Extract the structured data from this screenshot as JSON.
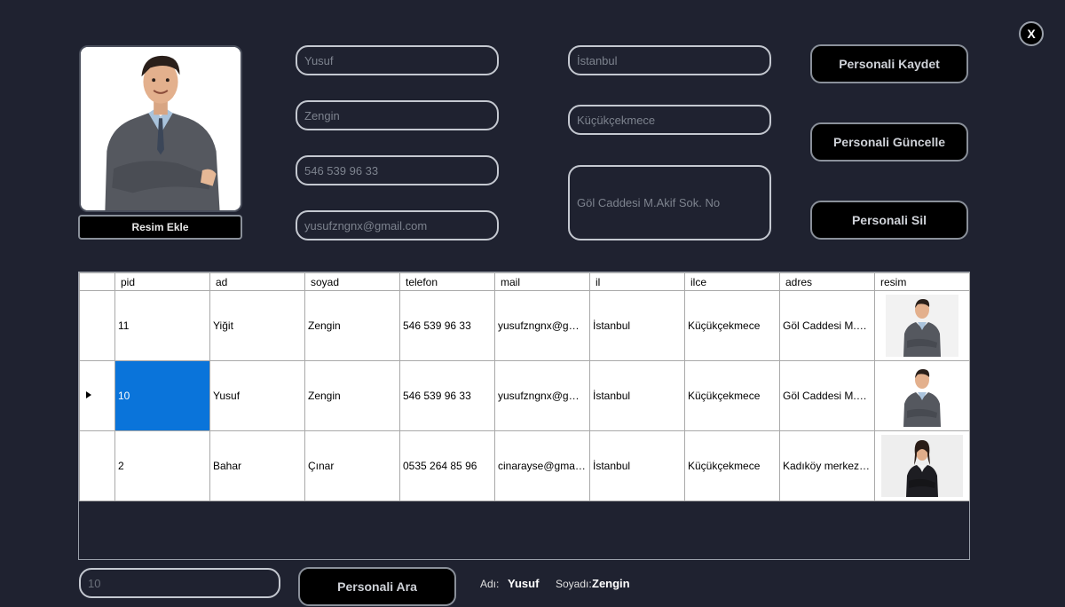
{
  "close_label": "X",
  "photo_button_label": "Resim Ekle",
  "form": {
    "ad": "Yusuf",
    "soyad": "Zengin",
    "telefon": "546 539 96 33",
    "mail": "yusufzngnx@gmail.com",
    "il": "İstanbul",
    "ilce": "Küçükçekmece",
    "adres": "Göl Caddesi M.Akif Sok. No"
  },
  "actions": {
    "save": "Personali Kaydet",
    "update": "Personali Güncelle",
    "delete": "Personali Sil"
  },
  "grid": {
    "columns": [
      "pid",
      "ad",
      "soyad",
      "telefon",
      "mail",
      "il",
      "ilce",
      "adres",
      "resim"
    ],
    "rows": [
      {
        "pid": "11",
        "ad": "Yiğit",
        "soyad": "Zengin",
        "telefon": "546 539 96 33",
        "mail": "yusufzngnx@gmail...",
        "il": "İstanbul",
        "ilce": "Küçükçekmece",
        "adres": "Göl Caddesi M.Akif...",
        "resim": "man"
      },
      {
        "pid": "10",
        "ad": "Yusuf",
        "soyad": "Zengin",
        "telefon": "546 539 96 33",
        "mail": "yusufzngnx@gmail...",
        "il": "İstanbul",
        "ilce": "Küçükçekmece",
        "adres": "Göl Caddesi M.Akif...",
        "resim": "man",
        "current": true
      },
      {
        "pid": "2",
        "ad": "Bahar",
        "soyad": "Çınar",
        "telefon": "0535 264 85 96",
        "mail": "cinarayse@gmail.c...",
        "il": "İstanbul",
        "ilce": "Küçükçekmece",
        "adres": "Kadıköy merkez m...",
        "resim": "woman"
      }
    ]
  },
  "search": {
    "value": "10",
    "button": "Personali Ara"
  },
  "result": {
    "ad_label": "Adı:",
    "ad_value": "Yusuf",
    "soyad_label": "Soyadı:",
    "soyad_value": "Zengin"
  },
  "colors": {
    "background": "#1f2230",
    "selection": "#0a74da"
  }
}
